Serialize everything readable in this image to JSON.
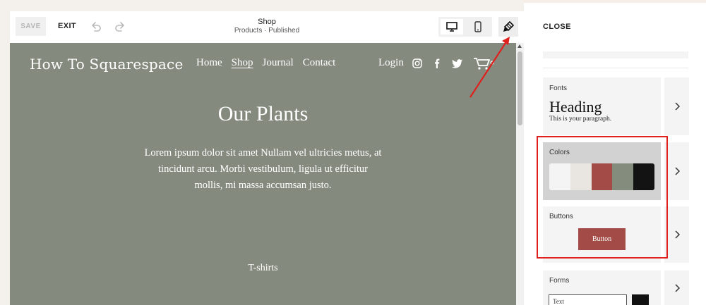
{
  "toolbar": {
    "save_label": "SAVE",
    "exit_label": "EXIT",
    "page_title": "Shop",
    "page_status": "Products · Published"
  },
  "site": {
    "logo": "How To Squarespace",
    "nav": [
      "Home",
      "Shop",
      "Journal",
      "Contact"
    ],
    "active_nav": "Shop",
    "login": "Login",
    "social_icons": [
      "instagram-icon",
      "facebook-icon",
      "twitter-icon",
      "cart-icon"
    ],
    "hero_title": "Our Plants",
    "hero_text": "Lorem ipsum dolor sit amet Nullam vel ultricies metus, at tincidunt arcu. Morbi vestibulum, ligula ut efficitur mollis, mi massa accumsan justo.",
    "section_label": "T-shirts",
    "background_color": "#848b7e"
  },
  "panel": {
    "close_label": "CLOSE",
    "fonts": {
      "label": "Fonts",
      "heading_sample": "Heading",
      "paragraph_sample": "This is your paragraph."
    },
    "colors": {
      "label": "Colors",
      "swatches": [
        "#f4f4f4",
        "#e9e5e0",
        "#a34c47",
        "#838c7d",
        "#131313"
      ]
    },
    "buttons": {
      "label": "Buttons",
      "sample_label": "Button",
      "sample_color": "#a34c47"
    },
    "forms": {
      "label": "Forms",
      "field_placeholder": "Text"
    }
  },
  "annotation": {
    "highlight_color": "#e0201c"
  }
}
